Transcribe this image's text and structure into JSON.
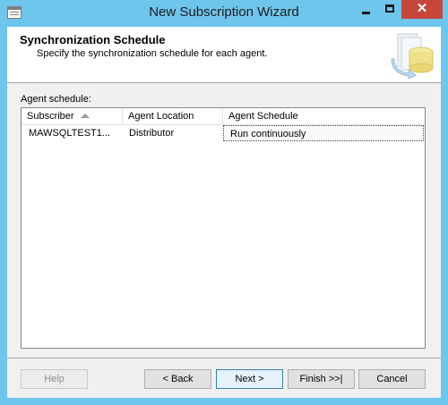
{
  "window": {
    "title": "New Subscription Wizard",
    "close_glyph": "✕",
    "icons": [
      "app-icon",
      "minimize-icon",
      "maximize-icon",
      "close-icon"
    ]
  },
  "header": {
    "title": "Synchronization Schedule",
    "subtitle": "Specify the synchronization schedule for each agent.",
    "art_icon": "wizard-database-icon"
  },
  "schedule": {
    "group_label": "Agent schedule:",
    "columns": [
      "Subscriber",
      "Agent Location",
      "Agent Schedule"
    ],
    "sort": {
      "column": "Subscriber",
      "direction": "ascending"
    },
    "rows": [
      {
        "subscriber": "MAWSQLTEST1...",
        "location": "Distributor",
        "schedule": "Run continuously"
      }
    ]
  },
  "buttons": {
    "help": "Help",
    "back": "< Back",
    "next": "Next >",
    "finish": "Finish >>|",
    "cancel": "Cancel"
  },
  "colors": {
    "titlebar": "#6fc6ec",
    "close_button": "#c7463a",
    "default_button_border": "#3c7fb1"
  }
}
